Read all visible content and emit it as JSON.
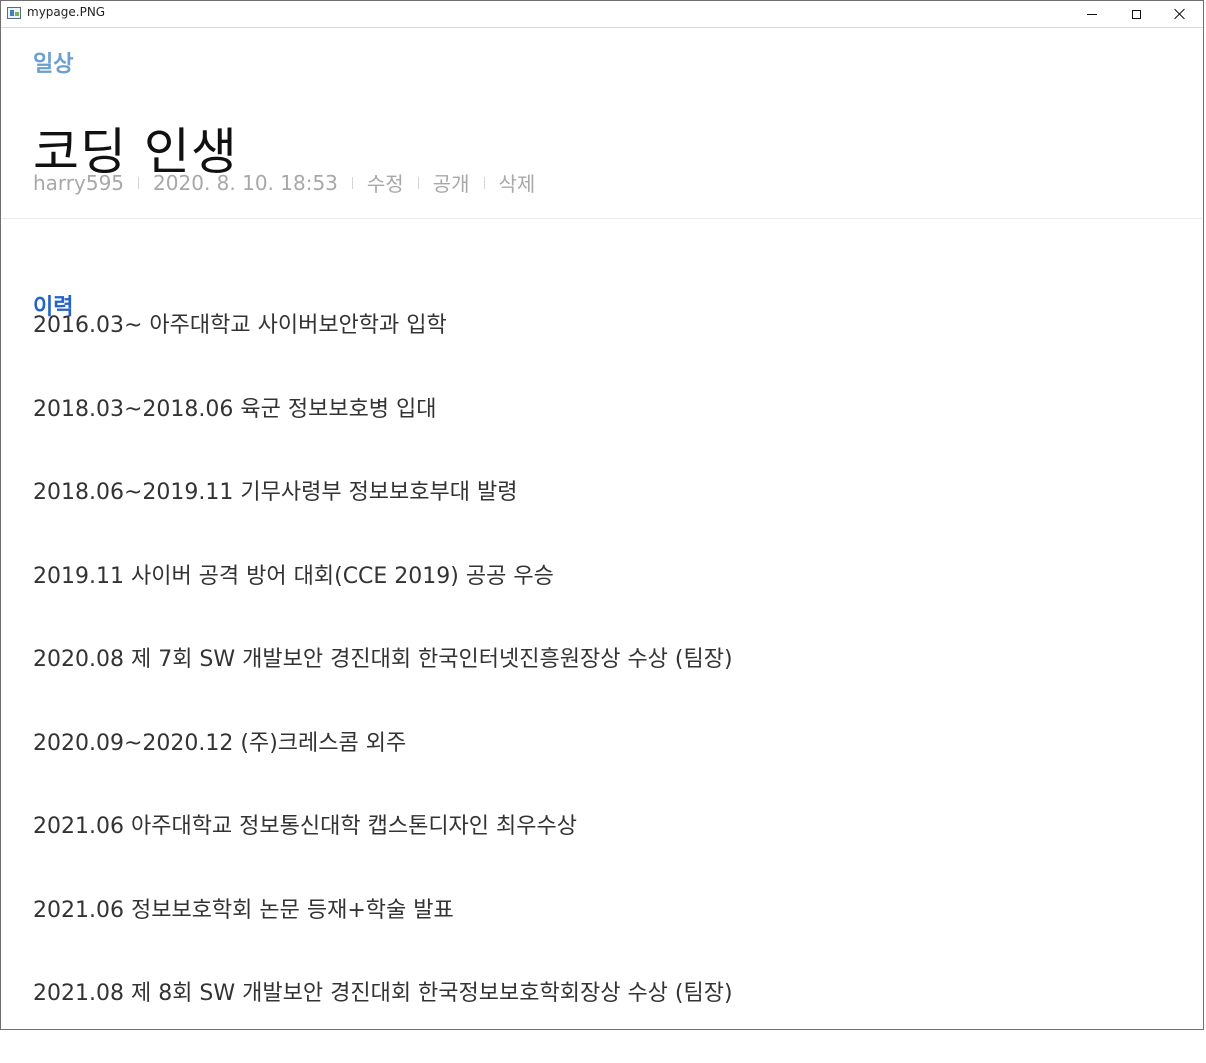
{
  "window": {
    "title": "mypage.PNG"
  },
  "post": {
    "category": "일상",
    "title": "코딩 인생",
    "meta": {
      "author": "harry595",
      "datetime": "2020. 8. 10. 18:53",
      "edit_label": "수정",
      "visibility_label": "공개",
      "delete_label": "삭제"
    }
  },
  "section": {
    "heading": "이력",
    "items": [
      "2016.03~ 아주대학교 사이버보안학과 입학",
      "2018.03~2018.06 육군 정보보호병 입대",
      "2018.06~2019.11 기무사령부 정보보호부대 발령",
      "2019.11 사이버 공격 방어 대회(CCE 2019) 공공 우승",
      "2020.08 제 7회 SW 개발보안 경진대회 한국인터넷진흥원장상 수상 (팀장)",
      "2020.09~2020.12 (주)크레스콤 외주",
      "2021.06 아주대학교 정보통신대학 캡스톤디자인 최우수상",
      "2021.06 정보보호학회 논문 등재+학술 발표",
      "2021.08 제 8회 SW 개발보안 경진대회 한국정보보호학회장상 수상 (팀장)"
    ]
  },
  "icons": {
    "app": "image-viewer-icon",
    "minimize": "minimize-icon",
    "maximize": "maximize-icon",
    "close": "close-icon"
  }
}
